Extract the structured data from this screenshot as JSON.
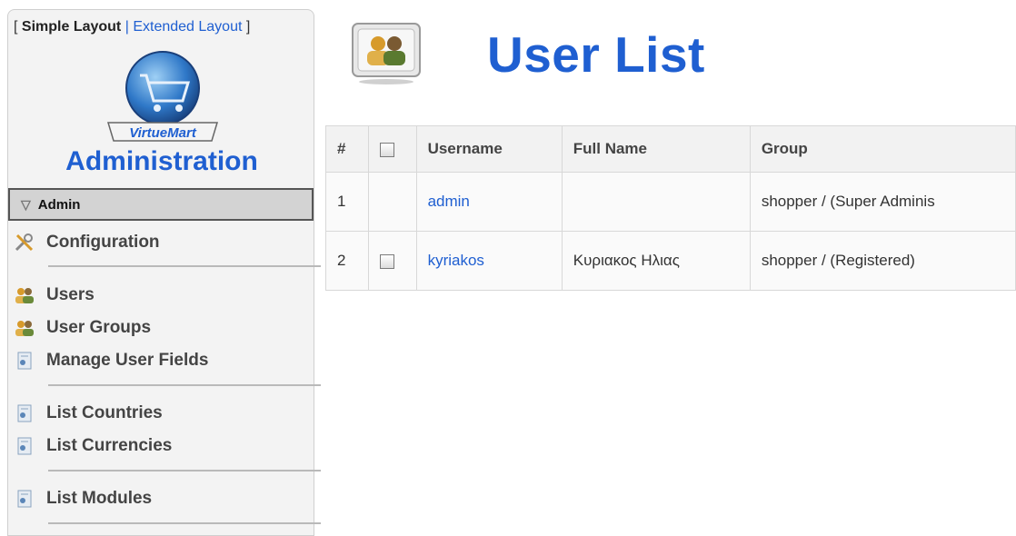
{
  "sidebar": {
    "layout_switch": {
      "open": "[",
      "simple": "Simple Layout",
      "sep": "|",
      "extended": "Extended Layout",
      "close": "]"
    },
    "logo_text": "VirtueMart",
    "admin_title": "Administration",
    "section_label": "Admin",
    "items": [
      {
        "label": "Configuration",
        "icon": "wrench-screwdriver-icon"
      },
      {
        "label": "Users",
        "icon": "users-icon"
      },
      {
        "label": "User Groups",
        "icon": "users-icon"
      },
      {
        "label": "Manage User Fields",
        "icon": "list-icon"
      },
      {
        "label": "List Countries",
        "icon": "list-icon"
      },
      {
        "label": "List Currencies",
        "icon": "list-icon"
      },
      {
        "label": "List Modules",
        "icon": "list-icon"
      }
    ]
  },
  "main": {
    "title": "User List",
    "columns": [
      "#",
      "",
      "Username",
      "Full Name",
      "Group"
    ],
    "rows": [
      {
        "num": "1",
        "username": "admin",
        "fullname": "",
        "group": "shopper / (Super Adminis"
      },
      {
        "num": "2",
        "username": "kyriakos",
        "fullname": "Κυριακος Ηλιας",
        "group": "shopper / (Registered)"
      }
    ]
  },
  "colors": {
    "accent": "#1f5fd1",
    "sidebar_bg": "#f3f3f3",
    "section_bg": "#d3d3d3"
  }
}
